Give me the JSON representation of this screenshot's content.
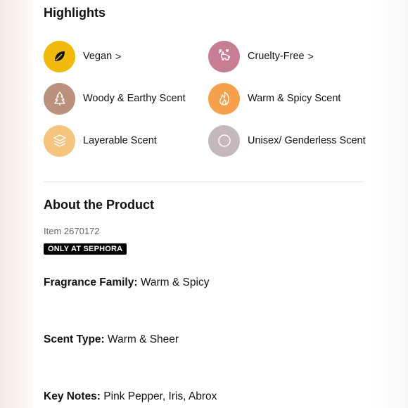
{
  "highlights": {
    "title": "Highlights",
    "items": [
      {
        "label": "Vegan",
        "chevron": ">",
        "icon": "leaf-icon",
        "color": "#f0b90b"
      },
      {
        "label": "Cruelty-Free",
        "chevron": ">",
        "icon": "bunny-icon",
        "color": "#c77e95"
      },
      {
        "label": "Woody & Earthy Scent",
        "icon": "tree-icon",
        "color": "#b9917c"
      },
      {
        "label": "Warm & Spicy Scent",
        "icon": "flame-icon",
        "color": "#f5a14c"
      },
      {
        "label": "Layerable Scent",
        "icon": "layers-icon",
        "color": "#f5c57f"
      },
      {
        "label": "Unisex/ Genderless Scent",
        "icon": "circle-icon",
        "color": "#c4b8bd"
      }
    ]
  },
  "about": {
    "title": "About the Product",
    "item_number": "Item 2670172",
    "badge": "ONLY AT SEPHORA",
    "specs": [
      {
        "label": "Fragrance Family:",
        "value": "Warm & Spicy"
      },
      {
        "label": "Scent Type:",
        "value": "Warm & Sheer"
      },
      {
        "label": "Key Notes:",
        "value": "Pink Pepper, Iris, Abrox"
      }
    ]
  }
}
